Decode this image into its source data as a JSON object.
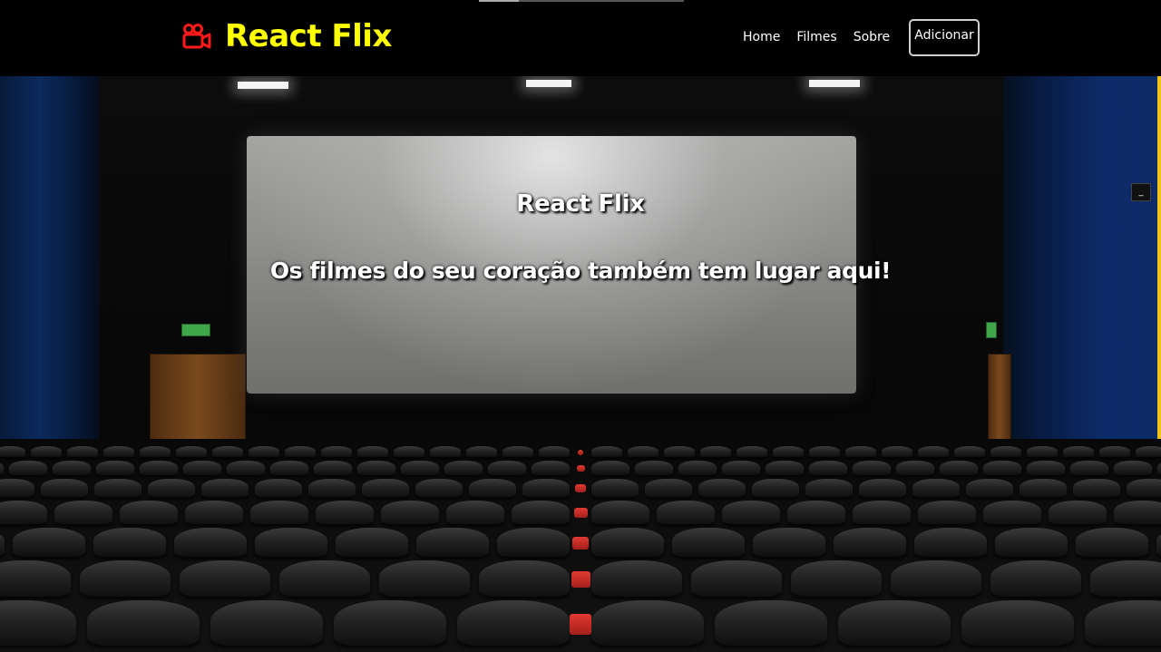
{
  "app": {
    "brand_title": "React Flix",
    "brand_icon": "movie-camera-icon",
    "brand_color": "#ffff00",
    "brand_icon_color": "#ff1a1a"
  },
  "nav": {
    "items": [
      {
        "label": "Home"
      },
      {
        "label": "Filmes"
      },
      {
        "label": "Sobre"
      }
    ],
    "add_button_label": "Adicionar"
  },
  "hero": {
    "title": "React Flix",
    "subtitle": "Os filmes do seu coração também tem lugar aqui!",
    "background": "cinema-theater-image"
  },
  "edge_widget": {
    "icon": "minimize-icon",
    "label": "_"
  },
  "colors": {
    "header_background": "#000000",
    "side_accent": "#f0c419"
  }
}
